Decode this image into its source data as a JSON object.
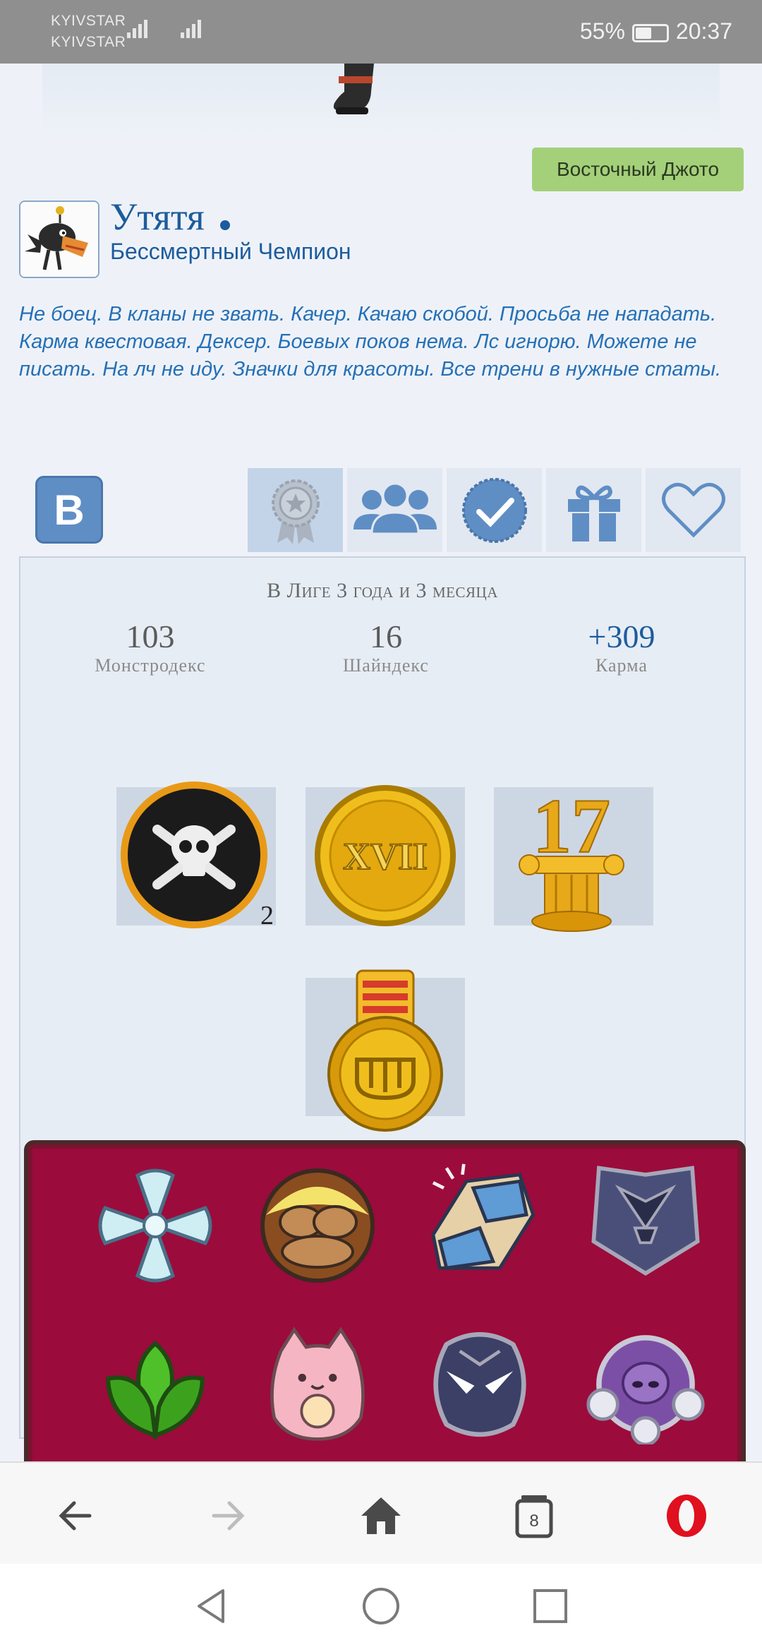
{
  "status_bar": {
    "carrier1": "KYIVSTAR",
    "carrier2": "KYIVSTAR",
    "network": "4G",
    "battery": "55%",
    "time": "20:37"
  },
  "profile": {
    "class_button": "Восточный Джото",
    "name": "Утятя",
    "rank": "Бессмертный Чемпион",
    "bio": "Не боец. В кланы не звать. Качер. Качаю скобой. Просьба не нападать. Карма квестовая. Дексер. Боевых поков нема. Лс игнорю. Можете не писать. На лч не иду. Значки для красоты. Все трени в нужные статы."
  },
  "tabs": {
    "vk_label": "B",
    "items": [
      "award-tab",
      "friends-tab",
      "verified-tab",
      "gifts-tab",
      "favorites-tab"
    ],
    "active": "award-tab"
  },
  "stats": {
    "league": "В Лиге 3 года и 3 месяца",
    "monstrodex_value": "103",
    "monstrodex_label": "Монстродекс",
    "shinydex_value": "16",
    "shinydex_label": "Шайндекс",
    "karma_value": "+309",
    "karma_label": "Карма"
  },
  "badges": {
    "pirate_count": "2",
    "coin_text": "XVII",
    "pedestal_text": "17"
  },
  "colors": {
    "accent": "#1d5c9c",
    "class_button": "#a4d07a",
    "board": "#9b0b3c"
  }
}
